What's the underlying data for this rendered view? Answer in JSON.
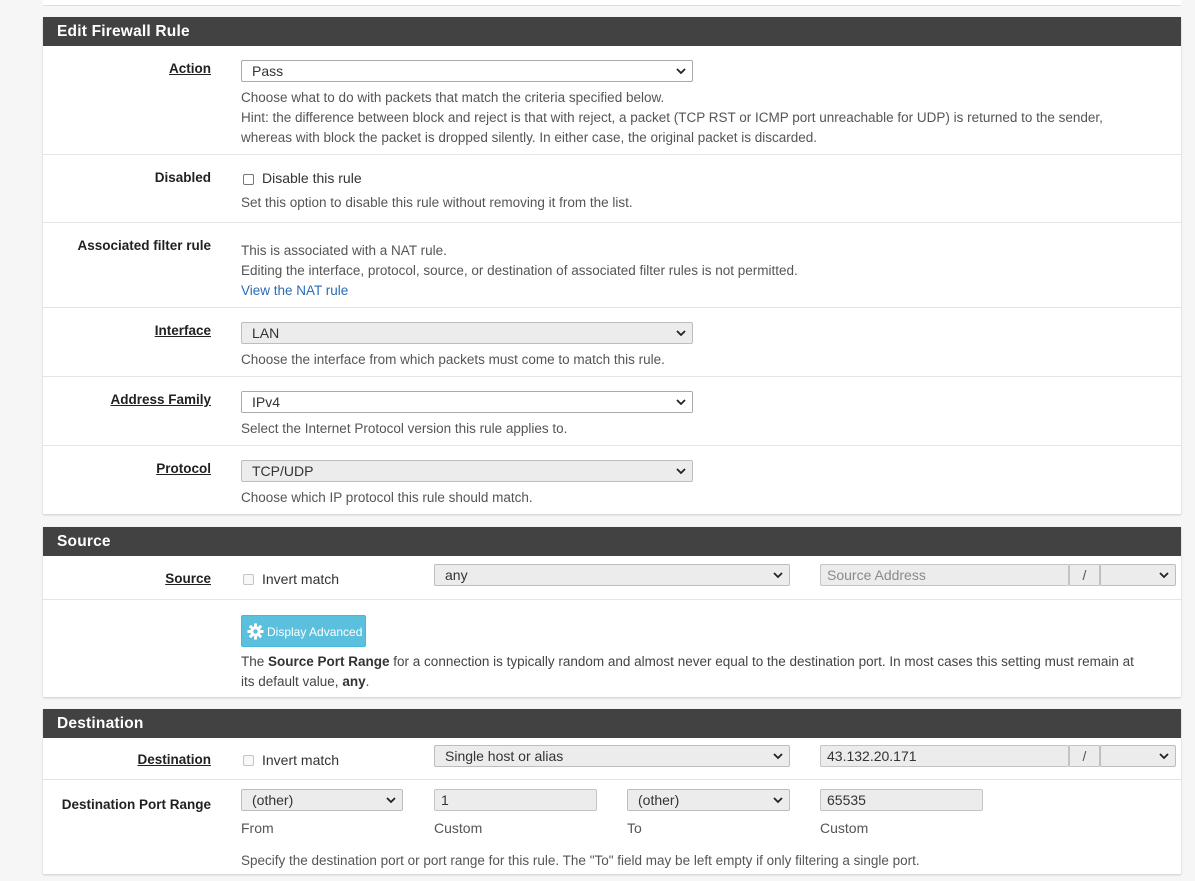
{
  "edit_panel": {
    "title": "Edit Firewall Rule",
    "action": {
      "label": "Action",
      "value": "Pass",
      "help": [
        "Choose what to do with packets that match the criteria specified below.",
        "Hint: the difference between block and reject is that with reject, a packet (TCP RST or ICMP port unreachable for UDP) is returned to the sender,",
        "whereas with block the packet is dropped silently. In either case, the original packet is discarded."
      ]
    },
    "disabled": {
      "label": "Disabled",
      "checkbox_label": "Disable this rule",
      "help": "Set this option to disable this rule without removing it from the list."
    },
    "associated": {
      "label": "Associated filter rule",
      "line1": "This is associated with a NAT rule.",
      "line2": "Editing the interface, protocol, source, or destination of associated filter rules is not permitted.",
      "link": "View the NAT rule"
    },
    "interface": {
      "label": "Interface",
      "value": "LAN",
      "help": "Choose the interface from which packets must come to match this rule."
    },
    "address_family": {
      "label": "Address Family",
      "value": "IPv4",
      "help": "Select the Internet Protocol version this rule applies to."
    },
    "protocol": {
      "label": "Protocol",
      "value": "TCP/UDP",
      "help": "Choose which IP protocol this rule should match."
    }
  },
  "source_panel": {
    "title": "Source",
    "label": "Source",
    "invert_label": "Invert match",
    "type_value": "any",
    "address_placeholder": "Source Address",
    "slash": "/",
    "mask_value": "",
    "advanced_button": "Display Advanced",
    "help_prefix": "The ",
    "help_bold": "Source Port Range",
    "help_mid": " for a connection is typically random and almost never equal to the destination port. In most cases this setting must remain at",
    "help_line2_prefix": "its default value, ",
    "help_line2_bold": "any",
    "help_line2_suffix": "."
  },
  "destination_panel": {
    "title": "Destination",
    "label": "Destination",
    "invert_label": "Invert match",
    "type_value": "Single host or alias",
    "address_value": "43.132.20.171",
    "slash": "/",
    "mask_value": "",
    "port_range": {
      "label": "Destination Port Range",
      "from_select": "(other)",
      "from_custom": "1",
      "to_select": "(other)",
      "to_custom": "65535",
      "from_caption": "From",
      "custom_caption": "Custom",
      "to_caption": "To",
      "custom_caption_2": "Custom",
      "help": "Specify the destination port or port range for this rule. The \"To\" field may be left empty if only filtering a single port."
    }
  },
  "colors": {
    "heading_bg": "#424242",
    "button_info": "#5bc0de",
    "link": "#2a6db5"
  }
}
